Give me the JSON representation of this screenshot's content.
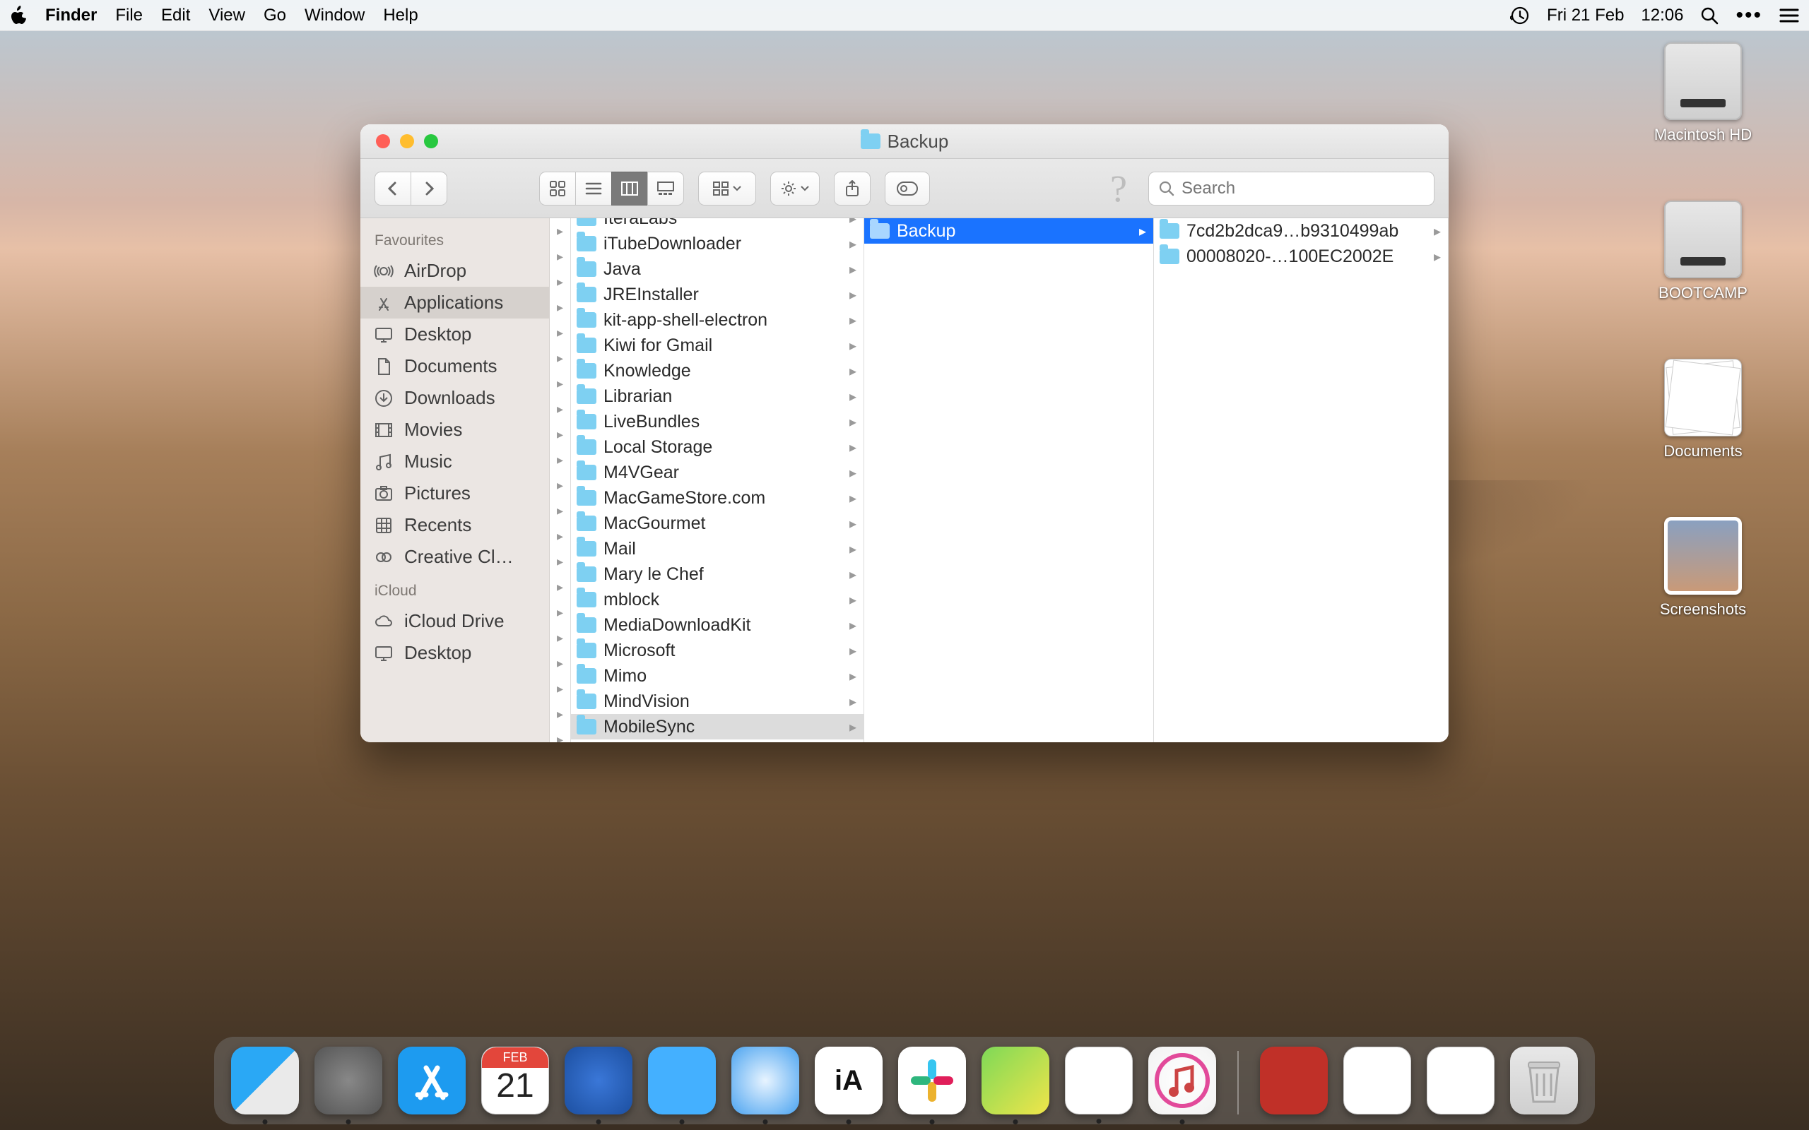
{
  "menubar": {
    "app": "Finder",
    "items": [
      "File",
      "Edit",
      "View",
      "Go",
      "Window",
      "Help"
    ],
    "date": "Fri 21 Feb",
    "time": "12:06"
  },
  "desktop_icons": [
    {
      "label": "Macintosh HD",
      "kind": "drive"
    },
    {
      "label": "BOOTCAMP",
      "kind": "drive"
    },
    {
      "label": "Documents",
      "kind": "docpile"
    },
    {
      "label": "Screenshots",
      "kind": "screenshot"
    }
  ],
  "finder": {
    "title": "Backup",
    "search_placeholder": "Search",
    "sidebar": {
      "sections": [
        {
          "title": "Favourites",
          "items": [
            {
              "icon": "airdrop",
              "label": "AirDrop"
            },
            {
              "icon": "apps",
              "label": "Applications",
              "selected": true
            },
            {
              "icon": "desktop",
              "label": "Desktop"
            },
            {
              "icon": "documents",
              "label": "Documents"
            },
            {
              "icon": "downloads",
              "label": "Downloads"
            },
            {
              "icon": "movies",
              "label": "Movies"
            },
            {
              "icon": "music",
              "label": "Music"
            },
            {
              "icon": "pictures",
              "label": "Pictures"
            },
            {
              "icon": "recents",
              "label": "Recents"
            },
            {
              "icon": "cc",
              "label": "Creative Cl…"
            }
          ]
        },
        {
          "title": "iCloud",
          "items": [
            {
              "icon": "icloud",
              "label": "iCloud Drive"
            },
            {
              "icon": "desktop",
              "label": "Desktop"
            }
          ]
        }
      ]
    },
    "columns": {
      "col1": [
        "IteraLabs",
        "iTubeDownloader",
        "Java",
        "JREInstaller",
        "kit-app-shell-electron",
        "Kiwi for Gmail",
        "Knowledge",
        "Librarian",
        "LiveBundles",
        "Local Storage",
        "M4VGear",
        "MacGameStore.com",
        "MacGourmet",
        "Mail",
        "Mary le Chef",
        "mblock",
        "MediaDownloadKit",
        "Microsoft",
        "Mimo",
        "MindVision",
        "MobileSync"
      ],
      "col1_selected_index": 20,
      "col2": [
        {
          "label": "Backup",
          "selected": true
        }
      ],
      "col3": [
        {
          "label": "7cd2b2dca9…b9310499ab"
        },
        {
          "label": "00008020-…100EC2002E"
        }
      ]
    }
  },
  "dock": {
    "calendar": {
      "month": "FEB",
      "day": "21"
    },
    "ia_label": "iA",
    "running": [
      true,
      true,
      false,
      false,
      true,
      true,
      true,
      true,
      true,
      true,
      true,
      true
    ],
    "apps": [
      "Finder",
      "Launchpad",
      "App Store",
      "Calendar",
      "Thunderbird",
      "Tweetbot",
      "Safari",
      "iA Writer",
      "Slack",
      "KeePass",
      "Notes",
      "iTunes"
    ],
    "right": [
      "OpenEmu",
      "TextDoc1",
      "TextDoc2",
      "Trash"
    ]
  }
}
